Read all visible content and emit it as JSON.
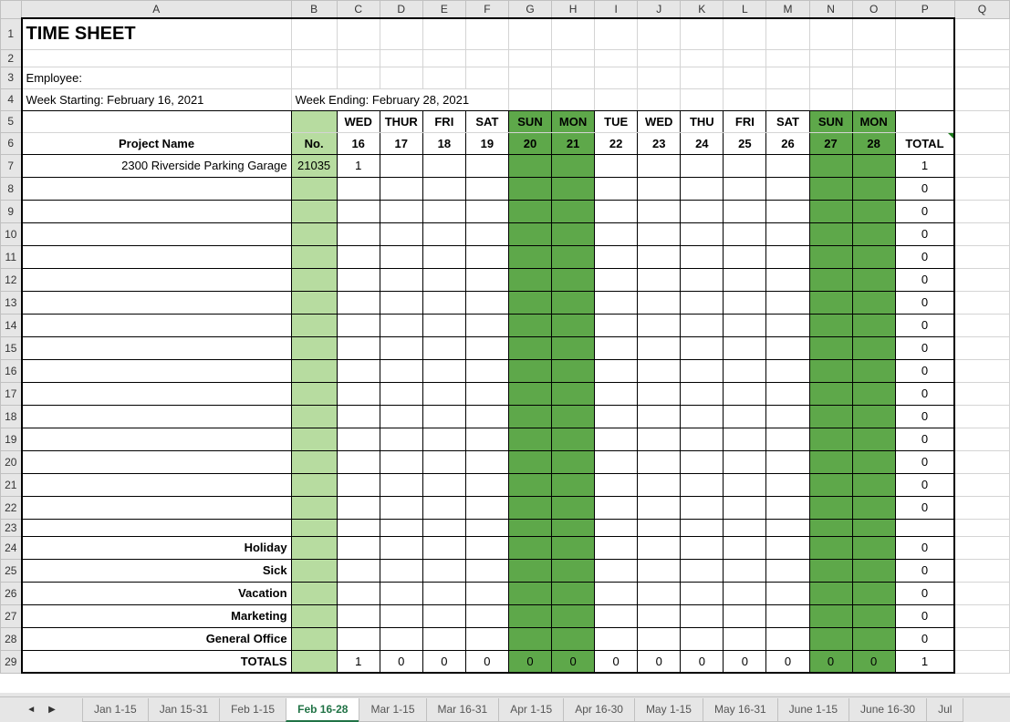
{
  "cols": [
    "A",
    "B",
    "C",
    "D",
    "E",
    "F",
    "G",
    "H",
    "I",
    "J",
    "K",
    "L",
    "M",
    "N",
    "O",
    "P",
    "Q"
  ],
  "title": "TIME SHEET",
  "employee_label": "Employee:",
  "week_start_label": "Week Starting: February 16, 2021",
  "week_end_label": "Week Ending: February 28, 2021",
  "project_name_hdr": "Project Name",
  "no_hdr": "No.",
  "total_hdr": "TOTAL",
  "days": [
    "WED",
    "THUR",
    "FRI",
    "SAT",
    "SUN",
    "MON",
    "TUE",
    "WED",
    "THU",
    "FRI",
    "SAT",
    "SUN",
    "MON"
  ],
  "dates": [
    "16",
    "17",
    "18",
    "19",
    "20",
    "21",
    "22",
    "23",
    "24",
    "25",
    "26",
    "27",
    "28"
  ],
  "weekend_idx": [
    4,
    5,
    11,
    12
  ],
  "rows": [
    {
      "name": "2300 Riverside Parking Garage",
      "no": "21035",
      "vals": [
        "1",
        "",
        "",
        "",
        "",
        "",
        "",
        "",
        "",
        "",
        "",
        "",
        ""
      ],
      "total": "1"
    },
    {
      "name": "",
      "no": "",
      "vals": [
        "",
        "",
        "",
        "",
        "",
        "",
        "",
        "",
        "",
        "",
        "",
        "",
        ""
      ],
      "total": "0"
    },
    {
      "name": "",
      "no": "",
      "vals": [
        "",
        "",
        "",
        "",
        "",
        "",
        "",
        "",
        "",
        "",
        "",
        "",
        ""
      ],
      "total": "0"
    },
    {
      "name": "",
      "no": "",
      "vals": [
        "",
        "",
        "",
        "",
        "",
        "",
        "",
        "",
        "",
        "",
        "",
        "",
        ""
      ],
      "total": "0"
    },
    {
      "name": "",
      "no": "",
      "vals": [
        "",
        "",
        "",
        "",
        "",
        "",
        "",
        "",
        "",
        "",
        "",
        "",
        ""
      ],
      "total": "0"
    },
    {
      "name": "",
      "no": "",
      "vals": [
        "",
        "",
        "",
        "",
        "",
        "",
        "",
        "",
        "",
        "",
        "",
        "",
        ""
      ],
      "total": "0"
    },
    {
      "name": "",
      "no": "",
      "vals": [
        "",
        "",
        "",
        "",
        "",
        "",
        "",
        "",
        "",
        "",
        "",
        "",
        ""
      ],
      "total": "0"
    },
    {
      "name": "",
      "no": "",
      "vals": [
        "",
        "",
        "",
        "",
        "",
        "",
        "",
        "",
        "",
        "",
        "",
        "",
        ""
      ],
      "total": "0"
    },
    {
      "name": "",
      "no": "",
      "vals": [
        "",
        "",
        "",
        "",
        "",
        "",
        "",
        "",
        "",
        "",
        "",
        "",
        ""
      ],
      "total": "0"
    },
    {
      "name": "",
      "no": "",
      "vals": [
        "",
        "",
        "",
        "",
        "",
        "",
        "",
        "",
        "",
        "",
        "",
        "",
        ""
      ],
      "total": "0"
    },
    {
      "name": "",
      "no": "",
      "vals": [
        "",
        "",
        "",
        "",
        "",
        "",
        "",
        "",
        "",
        "",
        "",
        "",
        ""
      ],
      "total": "0"
    },
    {
      "name": "",
      "no": "",
      "vals": [
        "",
        "",
        "",
        "",
        "",
        "",
        "",
        "",
        "",
        "",
        "",
        "",
        ""
      ],
      "total": "0"
    },
    {
      "name": "",
      "no": "",
      "vals": [
        "",
        "",
        "",
        "",
        "",
        "",
        "",
        "",
        "",
        "",
        "",
        "",
        ""
      ],
      "total": "0"
    },
    {
      "name": "",
      "no": "",
      "vals": [
        "",
        "",
        "",
        "",
        "",
        "",
        "",
        "",
        "",
        "",
        "",
        "",
        ""
      ],
      "total": "0"
    },
    {
      "name": "",
      "no": "",
      "vals": [
        "",
        "",
        "",
        "",
        "",
        "",
        "",
        "",
        "",
        "",
        "",
        "",
        ""
      ],
      "total": "0"
    },
    {
      "name": "",
      "no": "",
      "vals": [
        "",
        "",
        "",
        "",
        "",
        "",
        "",
        "",
        "",
        "",
        "",
        "",
        ""
      ],
      "total": "0"
    }
  ],
  "categories": [
    {
      "name": "Holiday",
      "total": "0"
    },
    {
      "name": "Sick",
      "total": "0"
    },
    {
      "name": "Vacation",
      "total": "0"
    },
    {
      "name": "Marketing",
      "total": "0"
    },
    {
      "name": "General Office",
      "total": "0"
    }
  ],
  "totals_label": "TOTALS",
  "totals": [
    "1",
    "0",
    "0",
    "0",
    "0",
    "0",
    "0",
    "0",
    "0",
    "0",
    "0",
    "0",
    "0"
  ],
  "grand_total": "1",
  "tabs": [
    "Jan 1-15",
    "Jan 15-31",
    "Feb 1-15",
    "Feb 16-28",
    "Mar 1-15",
    "Mar 16-31",
    "Apr 1-15",
    "Apr 16-30",
    "May 1-15",
    "May 16-31",
    "June 1-15",
    "June 16-30",
    "Jul"
  ],
  "active_tab": 3,
  "selected_row": 12
}
